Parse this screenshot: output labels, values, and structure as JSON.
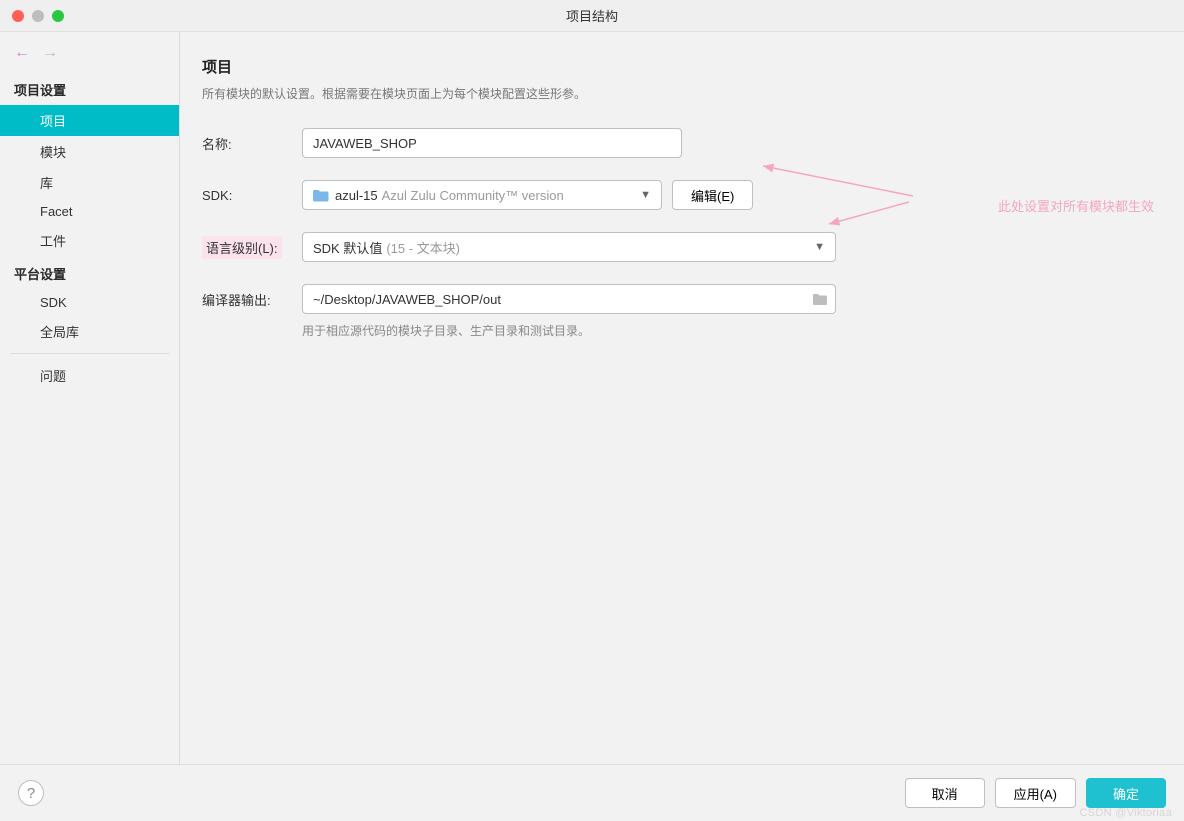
{
  "window": {
    "title": "项目结构"
  },
  "sidebar": {
    "sections": [
      {
        "title": "项目设置",
        "items": [
          "项目",
          "模块",
          "库",
          "Facet",
          "工件"
        ],
        "active_index": 0
      },
      {
        "title": "平台设置",
        "items": [
          "SDK",
          "全局库"
        ]
      }
    ],
    "extra": "问题"
  },
  "page": {
    "title": "项目",
    "description": "所有模块的默认设置。根据需要在模块页面上为每个模块配置这些形参。",
    "fields": {
      "name": {
        "label": "名称:",
        "value": "JAVAWEB_SHOP"
      },
      "sdk": {
        "label": "SDK:",
        "value_bold": "azul-15",
        "value_muted": "Azul Zulu Community™ version",
        "edit_button": "编辑(E)"
      },
      "lang_level": {
        "label": "语言级别(L):",
        "value_bold": "SDK 默认值",
        "value_muted": "(15 - 文本块)"
      },
      "output": {
        "label": "编译器输出:",
        "value": "~/Desktop/JAVAWEB_SHOP/out",
        "hint": "用于相应源代码的模块子目录、生产目录和测试目录。"
      }
    }
  },
  "annotation": {
    "text": "此处设置对所有模块都生效"
  },
  "footer": {
    "cancel": "取消",
    "apply": "应用(A)",
    "ok": "确定"
  },
  "watermark": "CSDN @Viktoriaa"
}
